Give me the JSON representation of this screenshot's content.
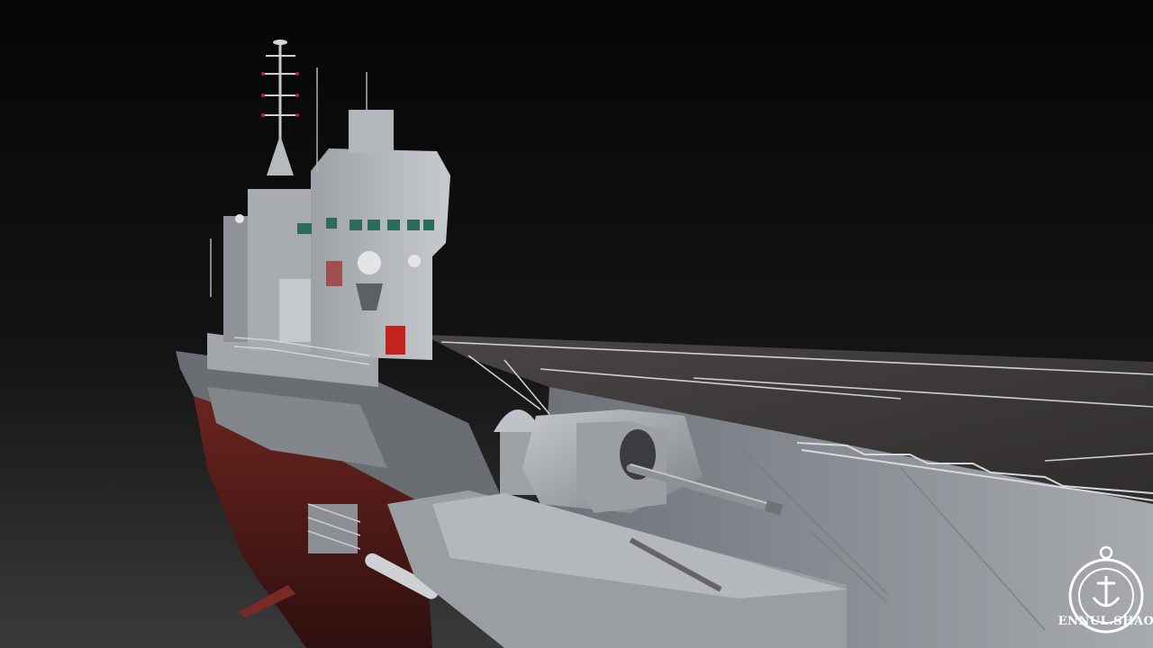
{
  "scene": {
    "subject": "aircraft-carrier-3d-render",
    "background_top": "#050505",
    "background_bottom": "#3a3a3a",
    "hull_red": "#5a1f1a",
    "deck_color": "#3b3838",
    "steel_light": "#b9bcc0",
    "steel_mid": "#8e9297",
    "steel_dark": "#5f6368",
    "window_green": "#2c6b5a",
    "accent_red": "#c2231e"
  },
  "watermark": {
    "text": "ENNUL.SHAO",
    "icon": "anchor-seal-icon",
    "color": "#ffffff"
  }
}
